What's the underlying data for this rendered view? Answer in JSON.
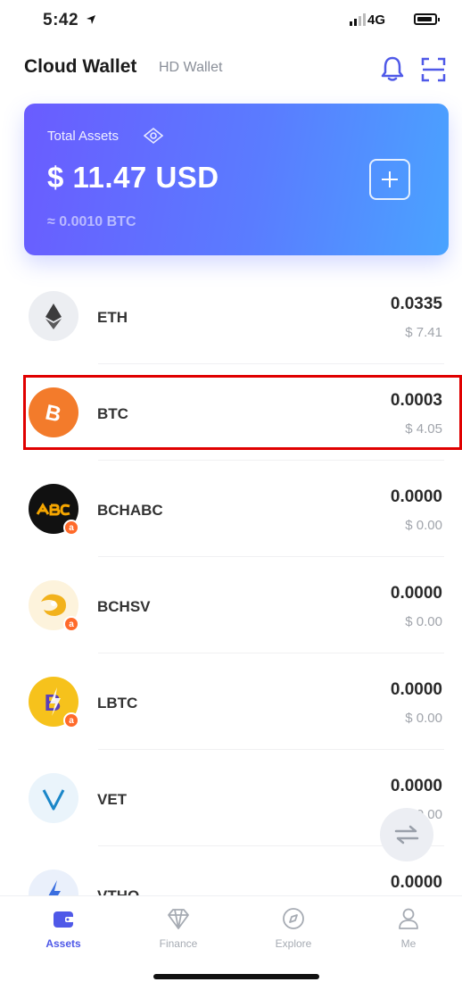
{
  "status_bar": {
    "time": "5:42",
    "network": "4G"
  },
  "header": {
    "title": "Cloud Wallet",
    "subtitle": "HD Wallet"
  },
  "card": {
    "label": "Total Assets",
    "total": "$ 11.47 USD",
    "btc_equiv": "≈ 0.0010 BTC"
  },
  "assets": [
    {
      "symbol": "ETH",
      "amount": "0.0335",
      "usd": "$ 7.41"
    },
    {
      "symbol": "BTC",
      "amount": "0.0003",
      "usd": "$ 4.05"
    },
    {
      "symbol": "BCHABC",
      "amount": "0.0000",
      "usd": "$ 0.00",
      "badge": "a"
    },
    {
      "symbol": "BCHSV",
      "amount": "0.0000",
      "usd": "$ 0.00",
      "badge": "a"
    },
    {
      "symbol": "LBTC",
      "amount": "0.0000",
      "usd": "$ 0.00",
      "badge": "a"
    },
    {
      "symbol": "VET",
      "amount": "0.0000",
      "usd": "$ 0.00"
    },
    {
      "symbol": "VTHO",
      "amount": "0.0000",
      "usd": ""
    }
  ],
  "tabs": {
    "assets": "Assets",
    "finance": "Finance",
    "explore": "Explore",
    "me": "Me"
  },
  "colors": {
    "accent": "#4f59e8",
    "card_start": "#6a5cff",
    "card_end": "#4aa3ff",
    "highlight": "#e00000"
  },
  "icons": [
    "location-arrow-icon",
    "signal-icon",
    "battery-icon",
    "bell-icon",
    "scan-icon",
    "eye-icon",
    "plus-icon",
    "swap-icon",
    "wallet-icon",
    "diamond-icon",
    "compass-icon",
    "person-icon"
  ]
}
